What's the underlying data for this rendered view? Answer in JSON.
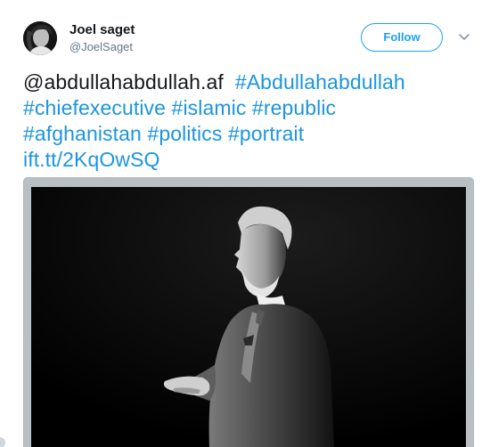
{
  "tweet": {
    "author": {
      "display_name": "Joel saget",
      "handle": "@JoelSaget",
      "avatar_icon": "avatar-photo"
    },
    "follow_label": "Follow",
    "menu_icon": "chevron-down-icon",
    "text": {
      "mention": "@abdullahabdullah.af",
      "hashtags": [
        "#Abdullahabdullah",
        "#chiefexecutive",
        "#islamic",
        "#republic",
        "#afghanistan",
        "#politics",
        "#portrait"
      ],
      "link": "ift.tt/2KqOwSQ"
    },
    "media": {
      "description_icon": "black-and-white-portrait-photo"
    }
  },
  "colors": {
    "accent": "#1da1f2",
    "link": "#1b95e0",
    "text": "#14171a",
    "secondary": "#657786"
  }
}
